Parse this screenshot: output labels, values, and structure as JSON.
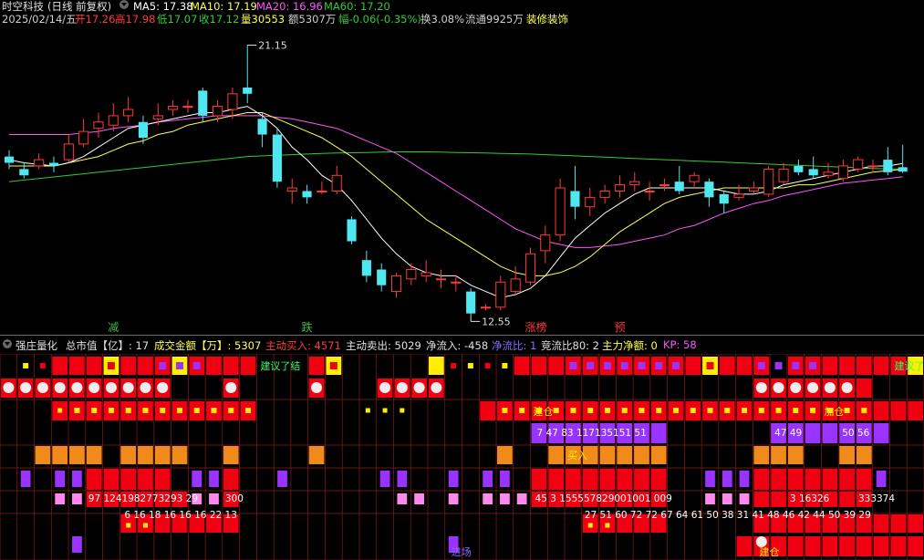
{
  "header": {
    "title": "时空科技",
    "mode": "(日线 前复权)",
    "ma5": "MA5: 17.38",
    "ma10": "MA10: 17.19",
    "ma20": "MA20: 16.96",
    "ma60": "MA60: 17.20",
    "date": "2025/02/14/五",
    "open": "开17.26",
    "high": "高17.98",
    "low": "低17.07",
    "close": "收17.12",
    "volume": "量30553",
    "amount": "额5307万",
    "change": "幅-0.06(-0.35%)",
    "turnover": "换3.08%",
    "float": "流通9925万",
    "sector": "装修装饰"
  },
  "chart_data": {
    "type": "candlestick",
    "ylim": [
      12.3,
      21.6
    ],
    "max_label": "21.15",
    "min_label": "12.55",
    "candles": [
      [
        17.6,
        17.4,
        17.8,
        17.2
      ],
      [
        17.2,
        17.0,
        17.4,
        16.9
      ],
      [
        17.3,
        17.5,
        17.7,
        17.2
      ],
      [
        17.4,
        17.3,
        17.6,
        17.1
      ],
      [
        17.5,
        18.0,
        18.3,
        17.4
      ],
      [
        18.0,
        18.4,
        18.8,
        17.9
      ],
      [
        18.5,
        18.7,
        19.0,
        18.2
      ],
      [
        18.6,
        18.9,
        19.3,
        18.4
      ],
      [
        18.9,
        19.1,
        19.5,
        18.7
      ],
      [
        18.7,
        18.2,
        18.9,
        18.0
      ],
      [
        18.8,
        18.9,
        19.3,
        18.6
      ],
      [
        19.1,
        19.2,
        19.4,
        18.9
      ],
      [
        19.2,
        19.2,
        19.4,
        19.0
      ],
      [
        19.7,
        18.9,
        19.8,
        18.7
      ],
      [
        18.9,
        19.2,
        19.4,
        18.7
      ],
      [
        19.1,
        19.6,
        19.8,
        18.8
      ],
      [
        19.8,
        19.6,
        21.15,
        19.3
      ],
      [
        18.8,
        18.3,
        19.0,
        17.9
      ],
      [
        18.3,
        16.8,
        18.5,
        16.6
      ],
      [
        16.5,
        16.6,
        16.9,
        16.1
      ],
      [
        16.5,
        16.3,
        16.7,
        16.1
      ],
      [
        16.5,
        16.5,
        16.8,
        16.4
      ],
      [
        16.5,
        17.0,
        17.3,
        16.4
      ],
      [
        15.6,
        14.9,
        15.7,
        14.8
      ],
      [
        14.3,
        13.8,
        14.6,
        13.6
      ],
      [
        14.0,
        13.5,
        14.2,
        13.3
      ],
      [
        13.3,
        13.8,
        13.9,
        13.1
      ],
      [
        13.7,
        14.0,
        14.2,
        13.5
      ],
      [
        13.8,
        13.9,
        14.3,
        13.6
      ],
      [
        13.7,
        13.7,
        14.0,
        13.4
      ],
      [
        13.6,
        13.6,
        13.8,
        13.3
      ],
      [
        13.3,
        12.6,
        13.4,
        12.55
      ],
      [
        12.8,
        12.8,
        12.9,
        12.7
      ],
      [
        12.8,
        13.6,
        13.8,
        12.7
      ],
      [
        13.3,
        13.7,
        14.1,
        13.2
      ],
      [
        13.6,
        14.5,
        14.7,
        13.5
      ],
      [
        14.6,
        15.1,
        15.4,
        14.2
      ],
      [
        15.1,
        16.6,
        16.9,
        14.9
      ],
      [
        16.5,
        16.0,
        17.3,
        15.6
      ],
      [
        16.0,
        16.3,
        16.6,
        15.7
      ],
      [
        16.3,
        16.5,
        16.7,
        16.1
      ],
      [
        16.5,
        16.7,
        17.0,
        16.3
      ],
      [
        16.7,
        16.8,
        17.1,
        16.5
      ],
      [
        16.5,
        16.5,
        16.8,
        16.2
      ],
      [
        16.7,
        16.7,
        16.9,
        16.5
      ],
      [
        16.8,
        16.5,
        17.3,
        16.4
      ],
      [
        16.8,
        17.0,
        17.1,
        16.6
      ],
      [
        16.8,
        16.3,
        16.9,
        16.0
      ],
      [
        16.4,
        16.1,
        16.5,
        15.8
      ],
      [
        16.3,
        16.4,
        16.7,
        16.2
      ],
      [
        16.5,
        16.6,
        16.8,
        16.4
      ],
      [
        16.4,
        17.2,
        17.3,
        16.3
      ],
      [
        16.8,
        17.2,
        17.4,
        16.7
      ],
      [
        17.3,
        17.1,
        17.5,
        17.0
      ],
      [
        17.2,
        17.0,
        17.6,
        16.9
      ],
      [
        17.0,
        17.1,
        17.4,
        16.9
      ],
      [
        16.9,
        17.3,
        17.5,
        16.8
      ],
      [
        17.2,
        17.5,
        17.6,
        17.1
      ],
      [
        17.3,
        17.3,
        17.5,
        17.1
      ],
      [
        17.5,
        17.1,
        17.9,
        17.0
      ],
      [
        17.26,
        17.12,
        17.98,
        17.07
      ]
    ],
    "ma5": [
      17.5,
      17.4,
      17.35,
      17.3,
      17.4,
      17.6,
      17.9,
      18.2,
      18.5,
      18.6,
      18.7,
      18.8,
      18.9,
      19.0,
      19.0,
      19.1,
      19.2,
      18.9,
      18.5,
      17.9,
      17.5,
      17.0,
      16.7,
      16.2,
      15.6,
      15.0,
      14.5,
      14.1,
      13.9,
      13.8,
      13.8,
      13.5,
      13.3,
      13.1,
      13.2,
      13.4,
      13.8,
      14.4,
      15.0,
      15.4,
      15.8,
      16.1,
      16.4,
      16.6,
      16.6,
      16.6,
      16.6,
      16.6,
      16.5,
      16.4,
      16.4,
      16.5,
      16.7,
      16.8,
      16.9,
      17.0,
      17.1,
      17.2,
      17.3,
      17.3,
      17.38
    ],
    "ma10": [
      17.3,
      17.3,
      17.3,
      17.3,
      17.4,
      17.5,
      17.6,
      17.8,
      18.0,
      18.1,
      18.3,
      18.4,
      18.6,
      18.7,
      18.8,
      18.9,
      19.0,
      19.0,
      18.8,
      18.6,
      18.4,
      18.2,
      17.9,
      17.6,
      17.2,
      16.8,
      16.4,
      16.0,
      15.6,
      15.3,
      15.0,
      14.7,
      14.4,
      14.1,
      13.9,
      13.8,
      13.8,
      13.9,
      14.1,
      14.4,
      14.8,
      15.2,
      15.5,
      15.8,
      16.1,
      16.3,
      16.4,
      16.5,
      16.6,
      16.6,
      16.6,
      16.6,
      16.6,
      16.7,
      16.7,
      16.8,
      16.9,
      17.0,
      17.1,
      17.15,
      17.19
    ],
    "ma20": [
      18.3,
      18.3,
      18.3,
      18.3,
      18.3,
      18.35,
      18.4,
      18.5,
      18.55,
      18.6,
      18.7,
      18.75,
      18.8,
      18.85,
      18.9,
      18.9,
      18.9,
      18.9,
      18.85,
      18.8,
      18.7,
      18.6,
      18.5,
      18.3,
      18.1,
      17.9,
      17.7,
      17.4,
      17.1,
      16.8,
      16.5,
      16.2,
      15.9,
      15.6,
      15.3,
      15.1,
      14.9,
      14.8,
      14.7,
      14.7,
      14.75,
      14.8,
      14.9,
      15.0,
      15.1,
      15.3,
      15.4,
      15.6,
      15.8,
      15.95,
      16.1,
      16.2,
      16.35,
      16.45,
      16.55,
      16.65,
      16.75,
      16.8,
      16.85,
      16.9,
      16.96
    ],
    "ma60": [
      16.8,
      16.85,
      16.9,
      16.95,
      17.0,
      17.05,
      17.1,
      17.15,
      17.2,
      17.25,
      17.3,
      17.35,
      17.4,
      17.45,
      17.5,
      17.55,
      17.6,
      17.62,
      17.64,
      17.66,
      17.68,
      17.7,
      17.71,
      17.72,
      17.73,
      17.74,
      17.75,
      17.75,
      17.75,
      17.74,
      17.73,
      17.72,
      17.71,
      17.7,
      17.69,
      17.68,
      17.66,
      17.64,
      17.62,
      17.6,
      17.58,
      17.56,
      17.54,
      17.52,
      17.5,
      17.48,
      17.46,
      17.44,
      17.42,
      17.4,
      17.38,
      17.36,
      17.34,
      17.32,
      17.3,
      17.28,
      17.26,
      17.24,
      17.22,
      17.21,
      17.2
    ],
    "signals": [
      {
        "index": 7,
        "text": "减",
        "color": "#3fbf3f"
      },
      {
        "index": 20,
        "text": "跌",
        "color": "#3fbf3f"
      },
      {
        "index": 35,
        "text": "涨榜",
        "color": "#ff3a3a"
      },
      {
        "index": 41,
        "text": "预",
        "color": "#ff3a3a"
      }
    ]
  },
  "indicator": {
    "name": "强庄量化",
    "market_cap": "总市值【亿】: 17",
    "turnover_amount": "成交金额【万】: 5307",
    "active_buy": "主动买入: 4571",
    "active_sell": "主动卖出: 5029",
    "net_inflow": "净流入: -458",
    "net_ratio": "净流比: 1",
    "bid_ratio": "竞流比80: 2",
    "main_net": "主力净额: 0",
    "kp": "KP: 58",
    "labels": {
      "suggest_end_1": "建议了结",
      "suggest_end_2": "建议了",
      "build": "建仓",
      "add": "加仓",
      "build2": "建仓",
      "buy_in": "买入",
      "build_pos": "建仓",
      "enter": "进场"
    },
    "row4_numbers": "7 47 83 117135151 51",
    "row4_right": "47 49",
    "row4_right2": "50 56",
    "row6_left": "97 1241982773293 29",
    "row6_mid": "300",
    "row6_center": "45 3 155557829001001 009",
    "row6_right": "3 16326",
    "row6_right2": "333374",
    "row7_left": "6 16 18 16 16 16 22 13",
    "row7_right": "27 51 60 72 72 67 64 61 50 38 31 41 48 46 42 44 50 39 29"
  },
  "colors": {
    "up": "#ff3a3a",
    "down": "#4fe7f0",
    "ma5": "#ffffff",
    "ma10": "#ffff55",
    "ma20": "#ff55ff",
    "ma60": "#33cc33",
    "grid": "#8a1a1a"
  }
}
